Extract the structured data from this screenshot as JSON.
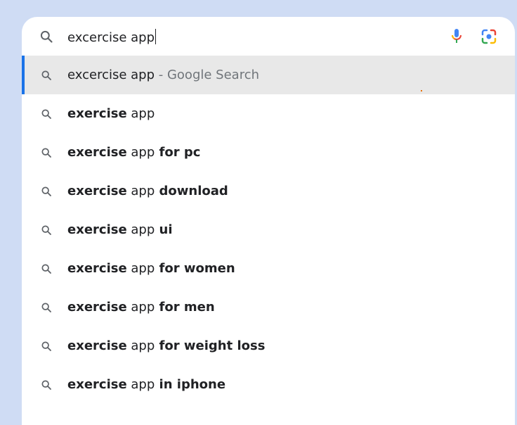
{
  "search": {
    "query": "excercise app",
    "icon": "search-icon",
    "voice_icon": "mic-icon",
    "lens_icon": "lens-icon"
  },
  "suggestions": [
    {
      "pre": "",
      "base": "excercise app",
      "post": " - Google Search",
      "selected": true
    },
    {
      "pre": "exercise",
      "base": " app",
      "post": ""
    },
    {
      "pre": "exercise",
      "base": " app",
      "post": " for pc"
    },
    {
      "pre": "exercise",
      "base": " app",
      "post": " download"
    },
    {
      "pre": "exercise",
      "base": " app",
      "post": " ui"
    },
    {
      "pre": "exercise",
      "base": " app",
      "post": " for women"
    },
    {
      "pre": "exercise",
      "base": " app",
      "post": " for men"
    },
    {
      "pre": "exercise",
      "base": " app",
      "post": " for weight loss"
    },
    {
      "pre": "exercise",
      "base": " app",
      "post": " in iphone"
    }
  ],
  "colors": {
    "accent": "#1a73e8",
    "background": "#cfdcf4",
    "selected_row": "#e8e8e8"
  }
}
